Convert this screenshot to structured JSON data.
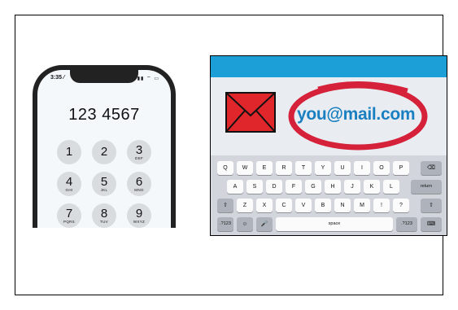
{
  "phone": {
    "status_time": "3:35 ⁄",
    "status_icons": "▮▮ ⌔ ▭",
    "dial_number": "123 4567",
    "keys": [
      {
        "digit": "1",
        "letters": ""
      },
      {
        "digit": "2",
        "letters": ""
      },
      {
        "digit": "3",
        "letters": "DEF"
      },
      {
        "digit": "4",
        "letters": "GHI"
      },
      {
        "digit": "5",
        "letters": "JKL"
      },
      {
        "digit": "6",
        "letters": "MNO"
      },
      {
        "digit": "7",
        "letters": "PQRS"
      },
      {
        "digit": "8",
        "letters": "TUV"
      },
      {
        "digit": "9",
        "letters": "WXYZ"
      }
    ]
  },
  "email": {
    "address": "you@mail.com",
    "envelope_color": "#e0262b",
    "ring_color": "#d6213a",
    "brand_blue": "#1b9fd6"
  },
  "keyboard": {
    "row1": [
      "Q",
      "W",
      "E",
      "R",
      "T",
      "Y",
      "U",
      "I",
      "O",
      "P",
      "⌫"
    ],
    "row2": [
      "A",
      "S",
      "D",
      "F",
      "G",
      "H",
      "J",
      "K",
      "L",
      "return"
    ],
    "row3": [
      "⇧",
      "Z",
      "X",
      "C",
      "V",
      "B",
      "N",
      "M",
      "!",
      "?",
      "⇧"
    ],
    "row4": [
      ".?123",
      "☺",
      "🎤",
      "space",
      ".?123",
      "⌨"
    ]
  }
}
